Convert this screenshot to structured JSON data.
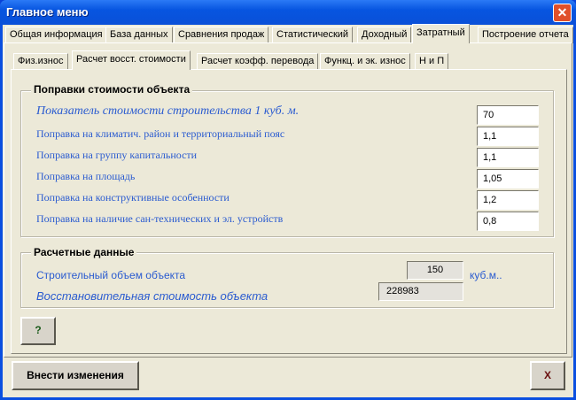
{
  "window": {
    "title": "Главное меню",
    "close_label": "✕"
  },
  "main_tabs": [
    {
      "label": "Общая информация"
    },
    {
      "label": "База данных"
    },
    {
      "label": "Сравнения продаж"
    },
    {
      "label": "Статистический"
    },
    {
      "label": "Доходный"
    },
    {
      "label": "Затратный",
      "selected": true
    },
    {
      "label": "Построение отчета"
    }
  ],
  "sub_tabs": [
    {
      "label": "Физ.износ"
    },
    {
      "label": "Расчет восст. стоимости",
      "selected": true
    },
    {
      "label": "Расчет коэфф. перевода"
    },
    {
      "label": "Функц. и эк. износ"
    },
    {
      "label": "Н и П"
    }
  ],
  "corrections": {
    "title": "Поправки стоимости объекта",
    "rows": [
      {
        "label": "Показатель стоимости строительства 1 куб. м.",
        "value": "70"
      },
      {
        "label": "Поправка на климатич. район и территориальный пояс",
        "value": "1,1"
      },
      {
        "label": "Поправка на группу капитальности",
        "value": "1,1"
      },
      {
        "label": "Поправка на площадь",
        "value": "1,05"
      },
      {
        "label": "Поправка на конструктивные особенности",
        "value": "1,2"
      },
      {
        "label": "Поправка на наличие сан-технических и эл. устройств",
        "value": "0,8"
      }
    ]
  },
  "calculated": {
    "title": "Расчетные данные",
    "volume_label": "Строительный объем объекта",
    "volume_value": "150",
    "volume_unit": "куб.м..",
    "cost_label": "Восстановительная стоимость объекта",
    "cost_value": "228983"
  },
  "buttons": {
    "help": "?",
    "apply": "Внести изменения",
    "close": "X"
  },
  "colors": {
    "label_blue": "#2a5bd0",
    "background": "#ece9d8",
    "title_bar": "#0755e0"
  }
}
